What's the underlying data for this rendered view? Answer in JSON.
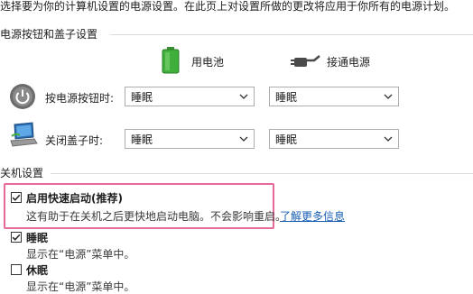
{
  "intro_text": "选择要为你的计算机设置的电源设置。在此页上对设置所做的更改将应用于你所有的电源计划。",
  "power_buttons": {
    "section_title": "电源按钮和盖子设置",
    "col_battery": "用电池",
    "col_plugged": "接通电源",
    "rows": [
      {
        "label": "按电源按钮时:",
        "battery": "睡眠",
        "plugged": "睡眠"
      },
      {
        "label": "关闭盖子时:",
        "battery": "睡眠",
        "plugged": "睡眠"
      }
    ]
  },
  "shutdown": {
    "section_title": "关机设置",
    "items": [
      {
        "label": "启用快速启动(推荐)",
        "checked": true,
        "desc": "这有助于在关机之后更快地启动电脑。不会影响重启。",
        "link": "了解更多信息"
      },
      {
        "label": "睡眠",
        "checked": true,
        "desc": "显示在“电源”菜单中。"
      },
      {
        "label": "休眠",
        "checked": false,
        "desc": "显示在“电源”菜单中。"
      }
    ]
  },
  "colors": {
    "highlight": "#e86a9a",
    "link": "#1a5fb4",
    "battery_green": "#3fae3a"
  }
}
